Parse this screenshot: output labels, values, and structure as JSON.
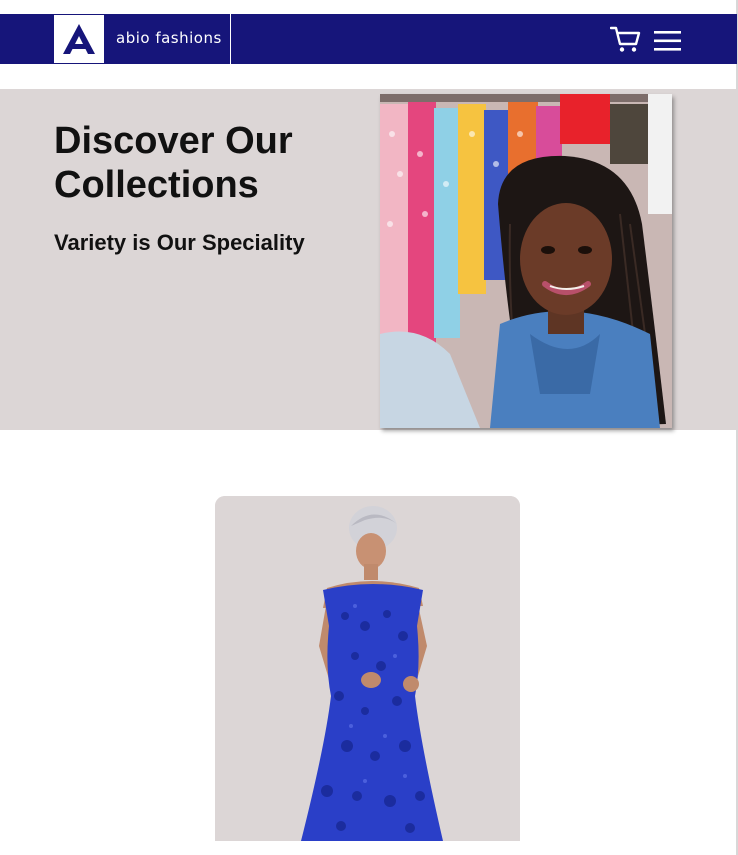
{
  "header": {
    "logo_letter": "A",
    "brand_name": "abio fashions",
    "brand_color": "#16157a",
    "cart_icon": "cart-icon",
    "menu_icon": "hamburger-menu-icon"
  },
  "hero": {
    "title": "Discover Our Collections",
    "subtitle": "Variety is Our Speciality",
    "background": "#dcd6d6",
    "image": "woman-at-clothing-rack-photo"
  },
  "product": {
    "image": "blue-lace-gown-photo",
    "background": "#dcd6d6"
  }
}
